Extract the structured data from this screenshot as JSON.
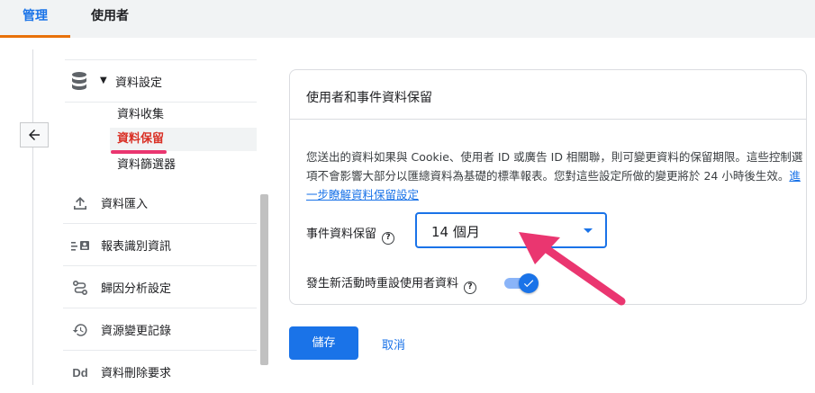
{
  "tabs": {
    "admin": "管理",
    "user": "使用者"
  },
  "sidebar": {
    "section_label": "資料設定",
    "sub_items": [
      "資料收集",
      "資料保留",
      "資料篩選器"
    ],
    "items": [
      {
        "label": "資料匯入",
        "icon": "upload-icon"
      },
      {
        "label": "報表識別資訊",
        "icon": "identity-icon"
      },
      {
        "label": "歸因分析設定",
        "icon": "attribution-icon"
      },
      {
        "label": "資源變更記錄",
        "icon": "history-icon"
      },
      {
        "label": "資料刪除要求",
        "icon": "data-deletion-icon",
        "icon_text": "Dd"
      }
    ]
  },
  "card": {
    "title": "使用者和事件資料保留",
    "description": "您送出的資料如果與 Cookie、使用者 ID 或廣告 ID 相關聯，則可變更資料的保留期限。這些控制選項不會影響大部分以匯總資料為基礎的標準報表。您對這些設定所做的變更將於 24 小時後生效。",
    "learn_more_link": "進一步瞭解資料保留設定",
    "event_retention_label": "事件資料保留",
    "event_retention_value": "14 個月",
    "reset_on_activity_label": "發生新活動時重設使用者資料",
    "reset_on_activity_enabled": true
  },
  "buttons": {
    "save": "儲存",
    "cancel": "取消"
  },
  "colors": {
    "accent": "#1a73e8",
    "active_tab_underline": "#e8710a",
    "annotation": "#ea3670",
    "active_item_text": "#d93025"
  }
}
